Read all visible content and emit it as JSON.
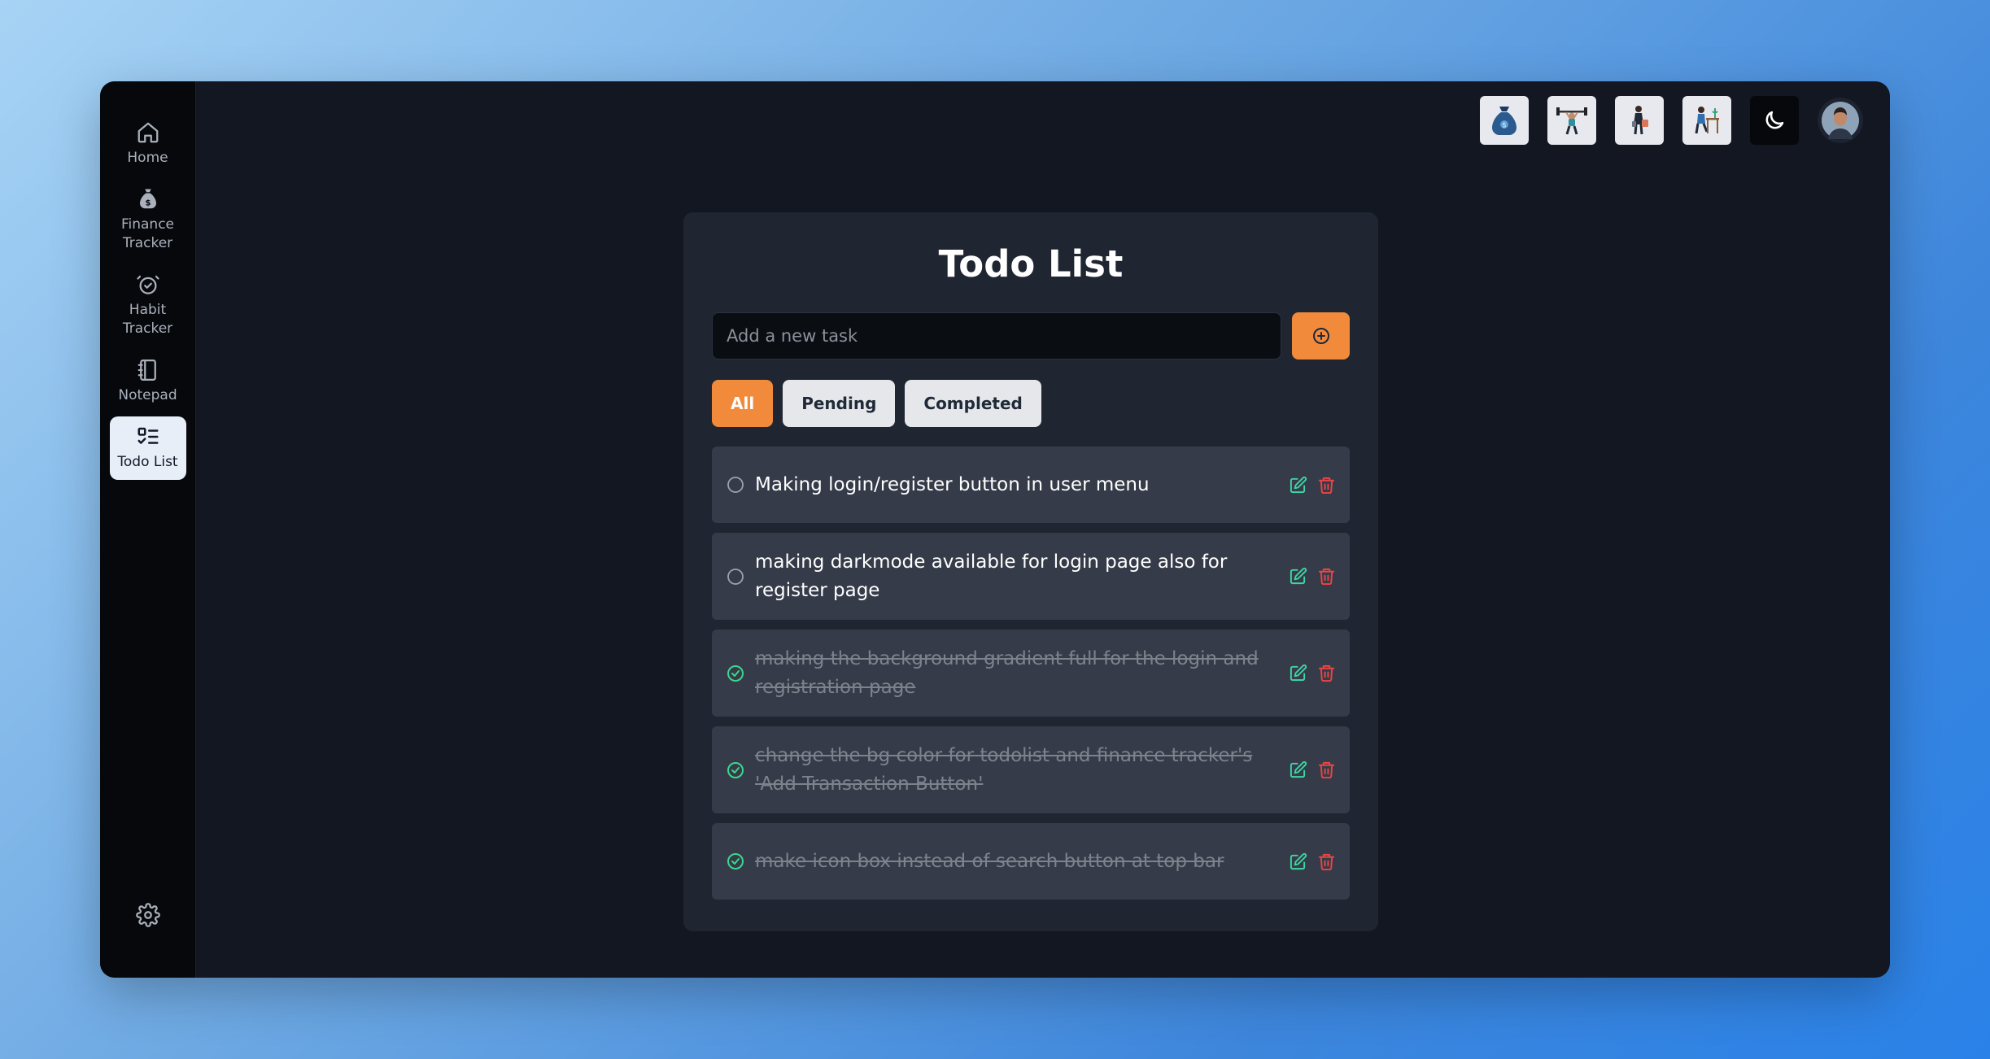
{
  "colors": {
    "accent": "#f28a3c",
    "card_bg": "#1f2631",
    "task_bg": "#353b48",
    "done_check": "#3dd68c",
    "edit_icon": "#3fd6a4",
    "delete_icon": "#ef4444"
  },
  "sidebar": {
    "items": [
      {
        "label": "Home",
        "icon": "home-icon"
      },
      {
        "label": "Finance Tracker",
        "icon": "money-bag-icon"
      },
      {
        "label": "Habit Tracker",
        "icon": "alarm-check-icon"
      },
      {
        "label": "Notepad",
        "icon": "notebook-icon"
      },
      {
        "label": "Todo List",
        "icon": "list-todo-icon",
        "active": true
      }
    ],
    "settings_icon": "gear-icon"
  },
  "topbar": {
    "icons": [
      "money-bag-illustration",
      "weightlifter-illustration",
      "person-shopping-illustration",
      "person-desk-illustration",
      "moon-icon",
      "user-avatar"
    ]
  },
  "todo": {
    "title": "Todo List",
    "input_placeholder": "Add a new task",
    "input_value": "",
    "add_icon": "plus-circle-icon",
    "filters": [
      {
        "label": "All",
        "active": true
      },
      {
        "label": "Pending",
        "active": false
      },
      {
        "label": "Completed",
        "active": false
      }
    ],
    "tasks": [
      {
        "text": "Making login/register button in user menu",
        "completed": false
      },
      {
        "text": "making darkmode available for login page also for register page",
        "completed": false
      },
      {
        "text": "making the background gradient full for the login and registration page",
        "completed": true
      },
      {
        "text": "change the bg color for todolist and finance tracker's 'Add Transaction Button'",
        "completed": true
      },
      {
        "text": "make icon box instead of search button at top bar",
        "completed": true
      }
    ]
  }
}
